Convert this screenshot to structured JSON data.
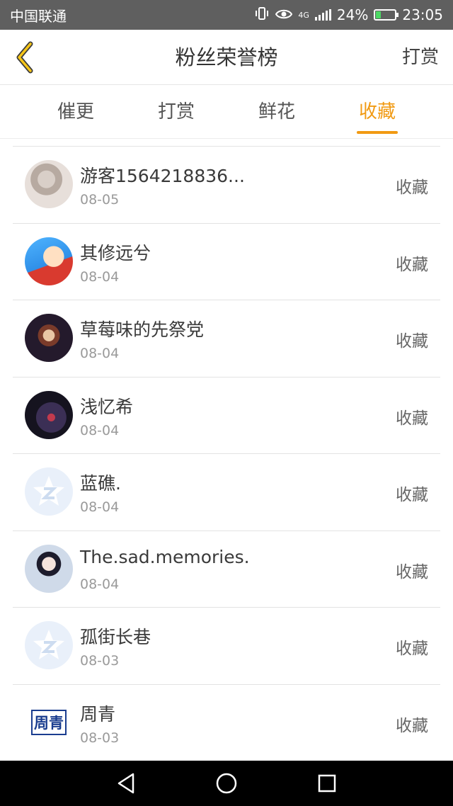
{
  "status_bar": {
    "carrier": "中国联通",
    "network": "4G",
    "battery_percent": "24%",
    "time": "23:05"
  },
  "nav": {
    "title": "粉丝荣誉榜",
    "right_action": "打赏"
  },
  "tabs": [
    {
      "label": "催更",
      "active": false
    },
    {
      "label": "打赏",
      "active": false
    },
    {
      "label": "鲜花",
      "active": false
    },
    {
      "label": "收藏",
      "active": true
    }
  ],
  "accent_color": "#f19a13",
  "fans": [
    {
      "name": "游客1564218836...",
      "date": "08-05",
      "action": "收藏"
    },
    {
      "name": "其修远兮",
      "date": "08-04",
      "action": "收藏"
    },
    {
      "name": "草莓味的先祭党",
      "date": "08-04",
      "action": "收藏"
    },
    {
      "name": "浅忆希",
      "date": "08-04",
      "action": "收藏"
    },
    {
      "name": "蓝礁.",
      "date": "08-04",
      "action": "收藏"
    },
    {
      "name": "The.sad.memories.",
      "date": "08-04",
      "action": "收藏"
    },
    {
      "name": "孤街长巷",
      "date": "08-03",
      "action": "收藏"
    },
    {
      "name": "周青",
      "date": "08-03",
      "action": "收藏",
      "avatar_text": "周青"
    }
  ]
}
